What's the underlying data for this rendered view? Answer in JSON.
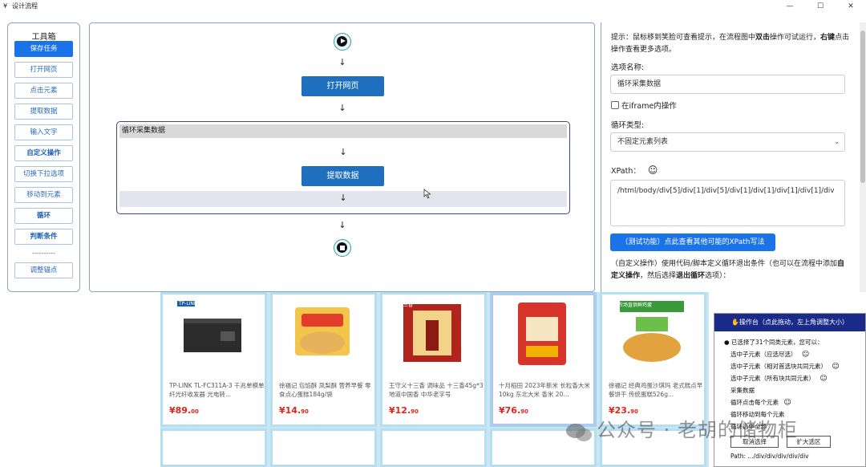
{
  "window": {
    "title": "设计流程",
    "controls": [
      "—",
      "☐",
      "✕"
    ]
  },
  "toolbox": {
    "title": "工具箱",
    "items": [
      {
        "label": "保存任务",
        "style": "primary"
      },
      {
        "label": "打开网页",
        "style": "normal"
      },
      {
        "label": "点击元素",
        "style": "normal"
      },
      {
        "label": "提取数据",
        "style": "normal"
      },
      {
        "label": "输入文字",
        "style": "normal"
      },
      {
        "label": "自定义操作",
        "style": "bold"
      },
      {
        "label": "切换下拉选项",
        "style": "normal"
      },
      {
        "label": "移动到元素",
        "style": "normal"
      },
      {
        "label": "循环",
        "style": "bold"
      },
      {
        "label": "判断条件",
        "style": "bold"
      }
    ],
    "separator": "----------",
    "items_after": [
      {
        "label": "调整锚点",
        "style": "normal"
      }
    ]
  },
  "flow": {
    "arrow": "↓",
    "open_page": "打开网页",
    "loop_title": "循环采集数据",
    "extract": "提取数据"
  },
  "panel": {
    "hint_prefix": "提示：鼠标移到笑脸可查看提示，在流程图中",
    "hint_dblclick": "双击",
    "hint_mid": "操作可试运行，",
    "hint_rightkey": "右键",
    "hint_suffix": "点击操作查看更多选项。",
    "option_name_label": "选项名称:",
    "option_name_value": "循环采集数据",
    "iframe_label": "在iframe内操作",
    "loop_type_label": "循环类型:",
    "loop_type_value": "不固定元素列表",
    "xpath_label": "XPath：",
    "xpath_value": "/html/body/div[5]/div[1]/div[5]/div[1]/div[1]/div[1]/div[1]/div",
    "test_button": "（测试功能）点此查看其他可能的XPath写法",
    "custom_prefix": "（自定义操作）使用代码/脚本定义循环退出条件（也可以在流程中添加",
    "custom_bold1": "自定义操作",
    "custom_mid": "，然后选择",
    "custom_bold2": "退出循环",
    "custom_suffix": "选项）："
  },
  "products": [
    {
      "title": "TP-LINK TL-FC311A-3 千兆单模单纤光纤收发器 光电转...",
      "price_int": "¥89.",
      "price_dec": "00"
    },
    {
      "title": "徐福记 包馅酥 凤梨酥 营养早餐 零食点心蛋糕184g/袋",
      "price_int": "¥14.",
      "price_dec": "90"
    },
    {
      "title": "王守义十三香 调味品 十三香45g*3 地道中国香 中华老字号",
      "price_int": "¥12.",
      "price_dec": "90"
    },
    {
      "title": "十月稻田 2023年新米 长粒香大米 10kg 东北大米 香米 20...",
      "price_int": "¥76.",
      "price_dec": "90"
    },
    {
      "title": "徐福记 经典鸡蛋沙琪玛 老式糕点早餐饼干 传统蛋糕526g...",
      "price_int": "¥23.",
      "price_dec": "90"
    }
  ],
  "product_labels": {
    "p1_brand": "TP-LINK",
    "p2_brand": "凤梨酥",
    "p3_brand": "十三香",
    "p5_banner": "农场直供鲜鸡蛋"
  },
  "console": {
    "title": "✋操作台（点此拖动，左上角调整大小）",
    "summary": "● 已选择了31个同类元素，您可以：",
    "options": [
      "选中子元素（应选尽选）",
      "选中子元素（相对首选块共同元素）",
      "选中子元素（所有块共同元素）",
      "采集数据",
      "循环点击每个元素",
      "循环移动到每个元素",
      "循环选中全部"
    ],
    "smile": "☺",
    "cancel": "取消选择",
    "expand": "扩大选区",
    "path": "Path: .../div/div/div/div/div"
  },
  "watermark": "公众号 · 老胡的储物柜"
}
